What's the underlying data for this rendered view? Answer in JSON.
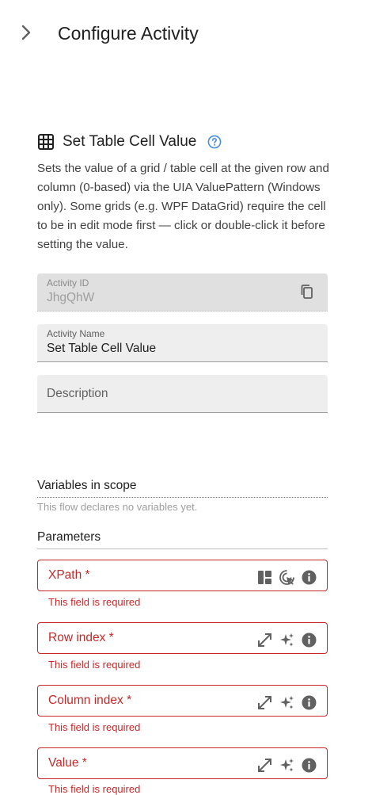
{
  "header": {
    "title": "Configure Activity",
    "collapse_icon": "chevron-right-icon"
  },
  "activity": {
    "icon": "table-grid-icon",
    "title": "Set Table Cell Value",
    "help_icon": "help-circle-icon",
    "description": "Sets the value of a grid / table cell at the given row and column (0-based) via the UIA ValuePattern (Windows only). Some grids (e.g. WPF DataGrid) require the cell to be in edit mode first — click or double-click it before setting the value."
  },
  "fields": {
    "activity_id": {
      "label": "Activity ID",
      "value": "JhgQhW",
      "icon": "copy-icon"
    },
    "activity_name": {
      "label": "Activity Name",
      "value": "Set Table Cell Value"
    },
    "description": {
      "label": "Description",
      "value": ""
    }
  },
  "variables": {
    "title": "Variables in scope",
    "empty_text": "This flow declares no variables yet."
  },
  "parameters": {
    "title": "Parameters",
    "items": [
      {
        "label": "XPath *",
        "error": "This field is required",
        "icons": [
          "layout-icon",
          "element-picker-icon",
          "info-icon"
        ]
      },
      {
        "label": "Row index *",
        "error": "This field is required",
        "icons": [
          "expand-icon",
          "sparkles-icon",
          "info-icon"
        ]
      },
      {
        "label": "Column index *",
        "error": "This field is required",
        "icons": [
          "expand-icon",
          "sparkles-icon",
          "info-icon"
        ]
      },
      {
        "label": "Value *",
        "error": "This field is required",
        "icons": [
          "expand-icon",
          "sparkles-icon",
          "info-icon"
        ]
      }
    ]
  },
  "colors": {
    "error": "#c62828",
    "field_bg": "#eeeeee",
    "help_blue": "#4a90d9",
    "icon_gray": "#616161"
  }
}
